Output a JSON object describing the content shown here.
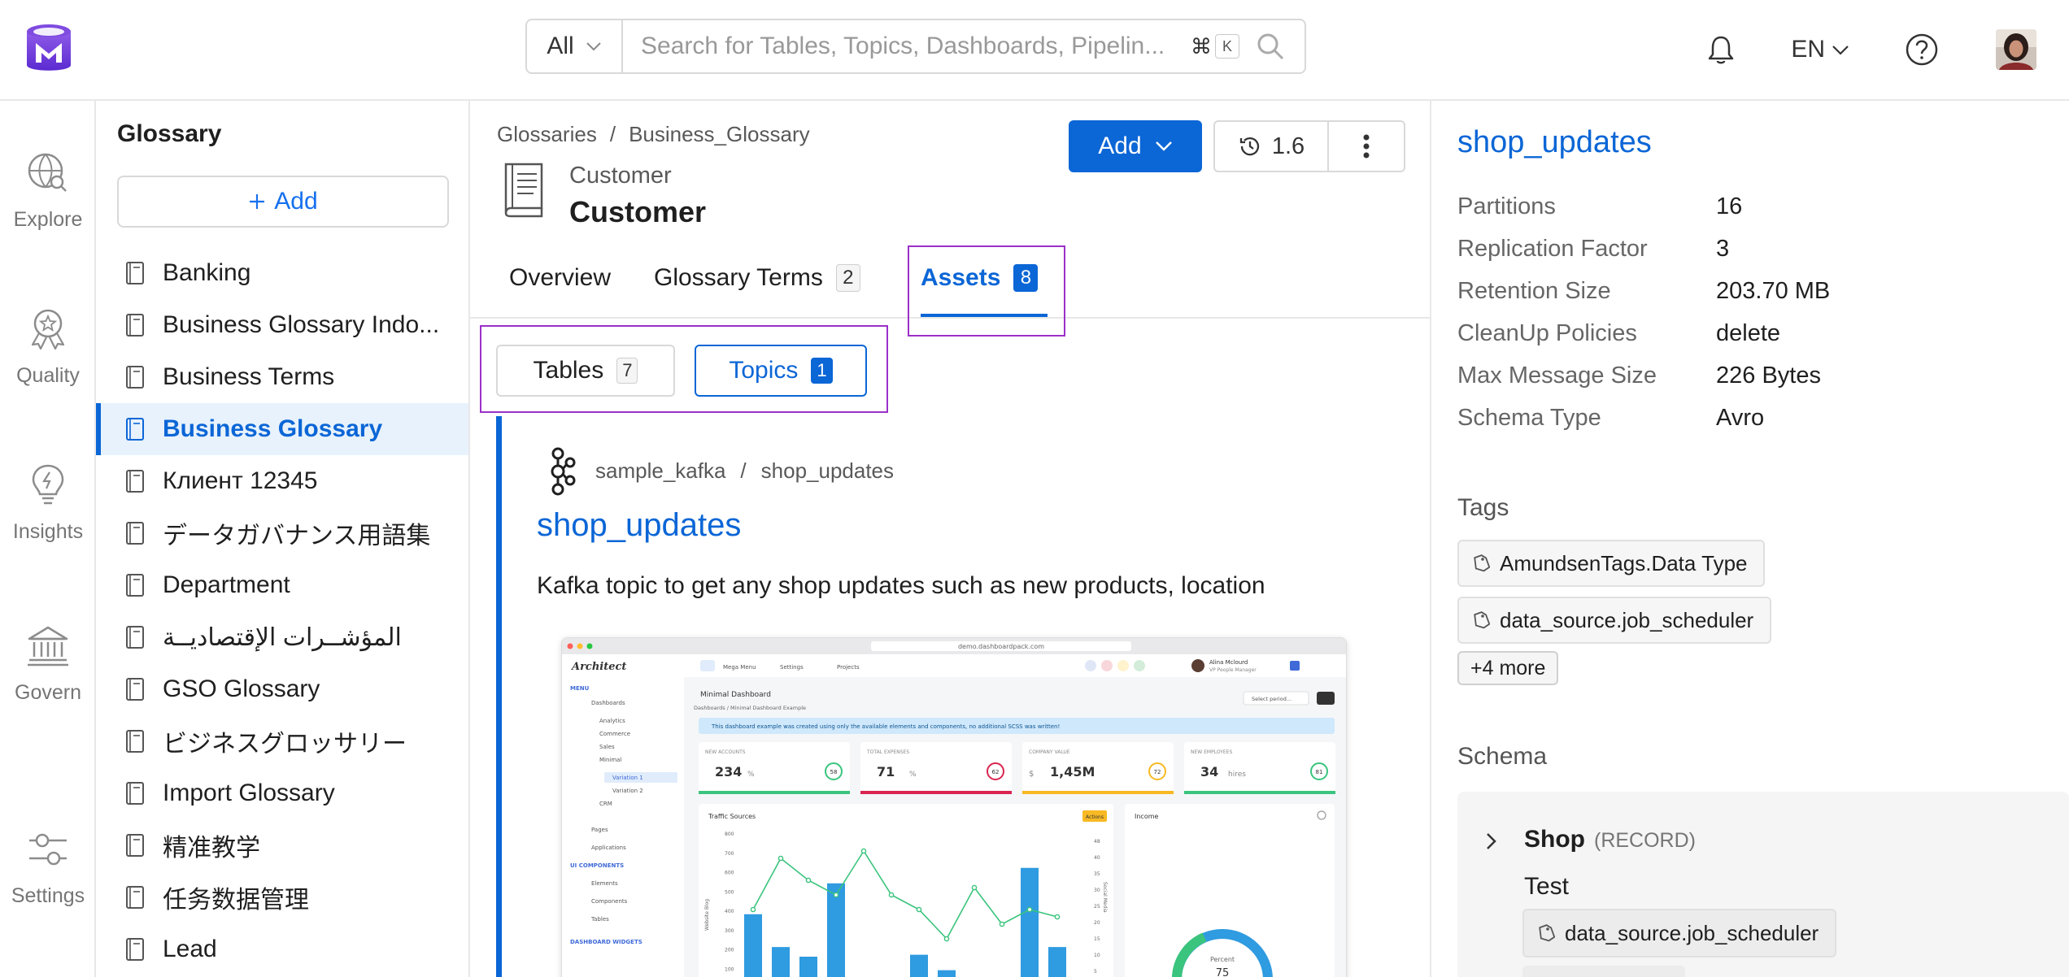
{
  "search": {
    "scope": "All",
    "placeholder": "Search for Tables, Topics, Dashboards, Pipelin...",
    "kbd_cmd": "⌘",
    "kbd_key": "K"
  },
  "header": {
    "language": "EN"
  },
  "rail": [
    {
      "label": "Explore",
      "icon": "explore-icon"
    },
    {
      "label": "Quality",
      "icon": "quality-icon"
    },
    {
      "label": "Insights",
      "icon": "insights-icon"
    },
    {
      "label": "Govern",
      "icon": "govern-icon"
    },
    {
      "label": "Settings",
      "icon": "settings-icon"
    }
  ],
  "glossary_sidebar": {
    "title": "Glossary",
    "add_label": "Add",
    "items": [
      {
        "label": "Banking"
      },
      {
        "label": "Business Glossary Indo..."
      },
      {
        "label": "Business Terms"
      },
      {
        "label": "Business Glossary",
        "active": true
      },
      {
        "label": "Клиент 12345"
      },
      {
        "label": "データガバナンス用語集"
      },
      {
        "label": "Department"
      },
      {
        "label": "المؤشــرات الإقتصاديــة"
      },
      {
        "label": "GSO Glossary"
      },
      {
        "label": "ビジネスグロッサリー"
      },
      {
        "label": "Import Glossary"
      },
      {
        "label": "精准教学"
      },
      {
        "label": "任务数据管理"
      },
      {
        "label": "Lead"
      }
    ]
  },
  "main": {
    "breadcrumb": [
      "Glossaries",
      "/",
      "Business_Glossary"
    ],
    "term_subtitle": "Customer",
    "term_title": "Customer",
    "add_button": "Add",
    "version": "1.6",
    "tabs": [
      {
        "label": "Overview",
        "count": ""
      },
      {
        "label": "Glossary Terms",
        "count": "2"
      },
      {
        "label": "Assets",
        "count": "8"
      }
    ],
    "subtabs": [
      {
        "label": "Tables",
        "count": "7"
      },
      {
        "label": "Topics",
        "count": "1"
      }
    ],
    "card": {
      "service": "sample_kafka",
      "separator": "/",
      "path_name": "shop_updates",
      "title": "shop_updates",
      "description": "Kafka topic to get any shop updates such as new products, location"
    }
  },
  "preview": {
    "url": "demo.dashboardpack.com",
    "brand": "Architect",
    "topmenu": [
      "Mega Menu",
      "Settings",
      "Projects"
    ],
    "user_name": "Alina Mclourd",
    "user_role": "VP People Manager",
    "menu_header": "MENU",
    "menu": [
      "Dashboards",
      "Analytics",
      "Commerce",
      "Sales",
      "Minimal",
      "Variation 1",
      "Variation 2",
      "CRM",
      "Pages",
      "Applications"
    ],
    "ui_header": "UI COMPONENTS",
    "ui_menu": [
      "Elements",
      "Components",
      "Tables"
    ],
    "widgets_header": "DASHBOARD WIDGETS",
    "page_title": "Minimal Dashboard",
    "page_crumbs": "Dashboards  /  Minimal Dashboard Example",
    "period": "Select period...",
    "notice": "This dashboard example was created using only the available elements and components, no additional SCSS was written!",
    "kpis": [
      {
        "label": "NEW ACCOUNTS",
        "value": "234",
        "unit": "%",
        "badge": "58",
        "color": "#3ac47d"
      },
      {
        "label": "TOTAL EXPENSES",
        "value": "71",
        "unit": "%",
        "badge": "62",
        "color": "#d92550"
      },
      {
        "label": "COMPANY VALUE",
        "value": "1,45M",
        "unit": "$",
        "badge": "72",
        "color": "#f7b924"
      },
      {
        "label": "NEW EMPLOYEES",
        "value": "34",
        "unit": "hires",
        "badge": "81",
        "color": "#3ac47d"
      }
    ],
    "traffic_title": "Traffic Sources",
    "actions_label": "Actions",
    "income_title": "Income",
    "percent_label": "Percent",
    "percent_value": "75",
    "y_ticks": [
      "800",
      "700",
      "600",
      "500",
      "400",
      "300",
      "200",
      "100"
    ],
    "y2_ticks": [
      "48",
      "40",
      "35",
      "30",
      "25",
      "20",
      "15",
      "10",
      "5"
    ],
    "y_axis_label": "Website Blog",
    "y2_axis_label": "Social Media",
    "bars": [
      380,
      210,
      160,
      540,
      0,
      0,
      170,
      90,
      0,
      0,
      620,
      210
    ],
    "line": [
      40,
      110,
      80,
      60,
      120,
      60,
      40,
      0,
      70,
      20,
      40,
      30
    ]
  },
  "right_panel": {
    "title": "shop_updates",
    "props": [
      {
        "key": "Partitions",
        "value": "16"
      },
      {
        "key": "Replication Factor",
        "value": "3"
      },
      {
        "key": "Retention Size",
        "value": "203.70 MB"
      },
      {
        "key": "CleanUp Policies",
        "value": "delete"
      },
      {
        "key": "Max Message Size",
        "value": "226 Bytes"
      },
      {
        "key": "Schema Type",
        "value": "Avro"
      }
    ],
    "tags_heading": "Tags",
    "tags": [
      "AmundsenTags.Data Type",
      "data_source.job_scheduler"
    ],
    "tags_more": "+4 more",
    "schema_heading": "Schema",
    "schema": {
      "name": "Shop",
      "type": "(RECORD)",
      "description": "Test",
      "tag": "data_source.job_scheduler"
    }
  },
  "colors": {
    "primary": "#0b66d6",
    "highlight": "#9b30c9",
    "active_bg": "#e8f2fd"
  }
}
